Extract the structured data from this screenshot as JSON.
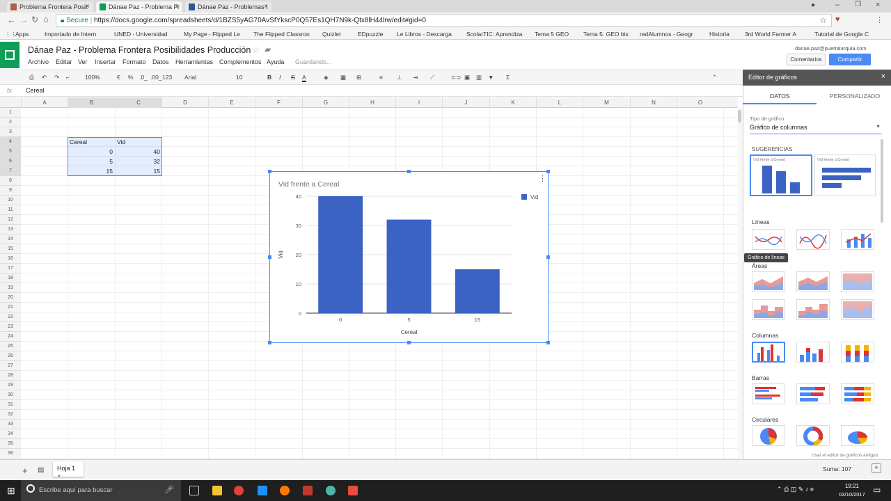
{
  "browser": {
    "tabs": [
      {
        "label": "Problema Frontera Posit"
      },
      {
        "label": "Dánae Paz - Problema Fr"
      },
      {
        "label": "Dánae Paz - Problemas I"
      }
    ],
    "secure_label": "Secure",
    "url": "https://docs.google.com/spreadsheets/d/1BZS5yAG70AvSfYkscP0Q57Es1QH7N9k-Qtx8lH44lrw/edit#gid=0",
    "bookmarks": [
      "Apps",
      "Importado de Intern",
      "UNED - Universidad",
      "My Page - Flipped Le",
      "The Flipped Classroo",
      "Quizlet",
      "EDpuzzle",
      "Le Libros - Descarga",
      "ScolarTIC: Aprendiza",
      "Tema 5 GEO",
      "Tema 5. GEO bis",
      "redAlumnos - Geogr",
      "Historia",
      "3rd World Farmer A",
      "Tutorial de Google C"
    ]
  },
  "doc": {
    "title": "Dánae Paz - Problema Frontera Posibilidades Producción",
    "menus": [
      "Archivo",
      "Editar",
      "Ver",
      "Insertar",
      "Formato",
      "Datos",
      "Herramientas",
      "Complementos",
      "Ayuda"
    ],
    "status": "Guardando...",
    "user_email": "danae.paz@puertalarquia.com",
    "comments_label": "Comentarios",
    "share_label": "Compartir"
  },
  "toolbar": {
    "zoom": "100%",
    "currency": "€",
    "percent": "%",
    "dec_less": ".0_",
    "dec_more": ".00_",
    "format": "123",
    "font": "Arial",
    "size": "10",
    "bold": "B",
    "italic": "I",
    "strike": "S",
    "textcolor": "A",
    "sigma": "Σ"
  },
  "formula": {
    "fx": "fx",
    "value": "Cereal"
  },
  "columns": [
    "A",
    "B",
    "C",
    "D",
    "E",
    "F",
    "G",
    "H",
    "I",
    "J",
    "K",
    "L",
    "M",
    "N",
    "O"
  ],
  "rows": [
    "1",
    "2",
    "3",
    "4",
    "5",
    "6",
    "7",
    "8",
    "9",
    "10",
    "11",
    "12",
    "13",
    "14",
    "15",
    "16",
    "17",
    "18",
    "19",
    "20",
    "21",
    "22",
    "23",
    "24",
    "25",
    "26",
    "27",
    "28",
    "29",
    "30",
    "31",
    "32",
    "33",
    "34",
    "35",
    "36"
  ],
  "cells": {
    "b4": "Cereal",
    "c4": "Vid",
    "b5": "0",
    "c5": "40",
    "b6": "5",
    "c6": "32",
    "b7": "15",
    "c7": "15"
  },
  "chart_data": {
    "type": "bar",
    "title": "Vid frente a Cereal",
    "categories": [
      "0",
      "5",
      "15"
    ],
    "series": [
      {
        "name": "Vid",
        "values": [
          40,
          32,
          15
        ],
        "color": "#3b63c4"
      }
    ],
    "xlabel": "Cereal",
    "ylabel": "Vid",
    "ylim": [
      0,
      40
    ],
    "yticks": [
      "0",
      "10",
      "20",
      "30",
      "40"
    ],
    "grid": true,
    "legend": "top-right"
  },
  "editor": {
    "title": "Editor de gráficos",
    "tab_data": "DATOS",
    "tab_custom": "PERSONALIZADO",
    "type_label": "Tipo de gráfico",
    "type_value": "Gráfico de columnas",
    "suggestions": "SUGERENCIAS",
    "suggestion_caption": "Vid frente a Cereal",
    "lines": "Líneas",
    "tooltip": "Gráfico de líneas",
    "areas": "Áreas",
    "columns": "Columnas",
    "bars": "Barras",
    "pies": "Circulares",
    "old_editor": "Usar el editor de gráficos antiguo"
  },
  "sheet": {
    "tab": "Hoja 1",
    "sum": "Suma: 107"
  },
  "taskbar": {
    "search": "Escribe aquí para buscar",
    "time": "19:21",
    "date": "03/10/2017"
  }
}
